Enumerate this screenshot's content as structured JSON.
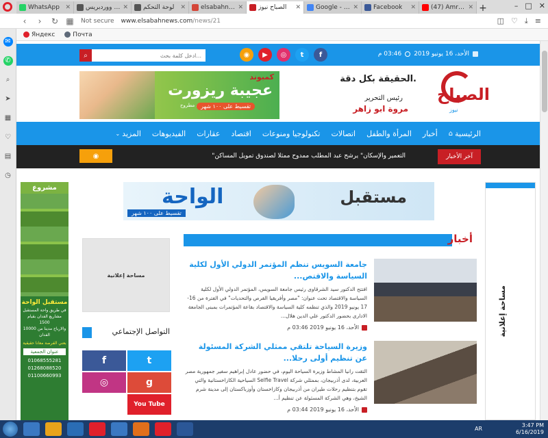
{
  "browser": {
    "tabs": [
      {
        "label": "WhatsApp",
        "color": "#25d366"
      },
      {
        "label": "سير ... ووردبريس",
        "color": "#555555"
      },
      {
        "label": "لوحة التحكم",
        "color": "#555555"
      },
      {
        "label": "elsabahnews",
        "color": "#d44638"
      },
      {
        "label": "الصباح نيوز",
        "color": "#c81f25",
        "active": true
      },
      {
        "label": "Google - بحث",
        "color": "#4285f4"
      },
      {
        "label": "Facebook",
        "color": "#3b5998"
      },
      {
        "label": "(47) Amr Dia",
        "color": "#ff0000"
      }
    ],
    "new_tab": "+",
    "not_secure": "Not secure",
    "url_domain": "www.elsabahnews.com",
    "url_path": "/news/21",
    "bookmarks": [
      {
        "label": "Яндекс",
        "color": "#e0202b"
      },
      {
        "label": "Почта",
        "color": "#5f6a79"
      }
    ]
  },
  "topbar": {
    "search_placeholder": "ادخل كلمة بحث...",
    "date": "الأحد، 16 يونيو 2019",
    "time": "03:46 م",
    "social": [
      {
        "icon": "rss-icon",
        "glyph": "◉",
        "color": "#f6a00b"
      },
      {
        "icon": "youtube-icon",
        "glyph": "▶",
        "color": "#e0202b"
      },
      {
        "icon": "instagram-icon",
        "glyph": "◎",
        "color": "#e1306c"
      },
      {
        "icon": "twitter-icon",
        "glyph": "t",
        "color": "#1da1f2"
      },
      {
        "icon": "facebook-icon",
        "glyph": "f",
        "color": "#3b5998"
      }
    ]
  },
  "header": {
    "slogan": "الحقيقة بكل دقة.",
    "chief_label": "رئيس التحرير",
    "chief_name": "مروة ابو زاهر",
    "logo_text": "الصباح",
    "logo_sub": "نيوز",
    "banner": {
      "line1": "كمبوند",
      "line2": "عجيبة ريزورت",
      "line3": "تقسيط على ١٠٠ شهر",
      "line4": "بمرسى مطروح"
    }
  },
  "nav": {
    "items": [
      "الرئيسية",
      "أخبار",
      "المرأة والطفل",
      "اتصالات",
      "تكنولوجيا ومنوعات",
      "اقتصاد",
      "عقارات",
      "الفيديوهات",
      "المزيد"
    ]
  },
  "ticker": {
    "label": "آخر الأخبار",
    "text": "\"التعمير والإسكان\" يرشح عبد المطلب ممدوح ممثلا لصندوق تمويل المساكن"
  },
  "left_ad": {
    "header": "مشروع",
    "name": "مستقبل الواحة",
    "lines": [
      "في طريق واحة المستقبل",
      "مشاريع الفدان بقيام 1500",
      "والارباح مدينا من 10000",
      "الفدان"
    ],
    "note": "بعني الفرصة معانا حقيقية",
    "addr_label": "عنوان الجمعية",
    "phones": [
      "01068555281",
      "01268088520",
      "01100660993"
    ]
  },
  "right_ad": {
    "label": "مساحة إعلانية"
  },
  "mid_banner": {
    "left": "الواحة",
    "right": "مستقبل",
    "sub": "تقسيط على ١٠٠ شهر"
  },
  "side": {
    "ad_label": "مساحة إعلانية",
    "social_title": "التواصل الإجتماعي",
    "social_grid": [
      {
        "icon": "facebook-icon",
        "glyph": "f",
        "color": "#3b5998"
      },
      {
        "icon": "twitter-icon",
        "glyph": "t",
        "color": "#1da1f2"
      },
      {
        "icon": "instagram-icon",
        "glyph": "◎",
        "color": "#c13584"
      },
      {
        "icon": "google-plus-icon",
        "glyph": "g",
        "color": "#dd4b39"
      },
      {
        "icon": "youtube-icon",
        "glyph": "You Tube",
        "color": "#e0202b"
      }
    ]
  },
  "section": {
    "title": "أخبار"
  },
  "articles": [
    {
      "title": "جامعة السويس تنظم المؤتمر الدولي الأول لكلية السياسة والاقتص...",
      "body": "افتتح الدكتور سيد الشرقاوى رئيس جامعة السويس، المؤتمر الدولي الأول لكلية السياسة والاقتصاد تحت عنوان: \"مصر وأفريقيا الفرص والتحديات\" في الفترة من 16- 17 يونيو 2019 والذي تنظمه كلية السياسة والاقتصاد بقاعة المؤتمرات بمبنى الجامعة الادارى بحضور الدكتور علي الدين هلال...",
      "date": "الأحد، 16 يونيو 2019 03:46 م"
    },
    {
      "title": "وزيرة السياحة تلتقي ممثلي الشركة المسئولة عن تنظيم أولى رحلا...",
      "body": "التقت رانيا المشاط وزيرة السياحة اليوم، في حضور عادل إبراهيم سفير جمهورية مصر العربية، لدى أذربيجان، بممثلي شركة Selfie Travel السياحية الكازاخستانية والتي تقوم بتنظيم رحلات طيران من أذربيجان وكازاخستان وأوزباكستان إلى مدينة شرم الشيخ، وهي الشركة المسئولة عن تنظيم أ...",
      "date": "الأحد، 16 يونيو 2019 03:44 م"
    }
  ],
  "taskbar": {
    "lang": "AR",
    "time": "3:47 PM",
    "date": "6/16/2019",
    "apps": [
      "#3a78c2",
      "#e8a31b",
      "#2a6db5",
      "#e0202b",
      "#3a78c2",
      "#e06f1b",
      "#e0202b",
      "#2b5797"
    ]
  }
}
